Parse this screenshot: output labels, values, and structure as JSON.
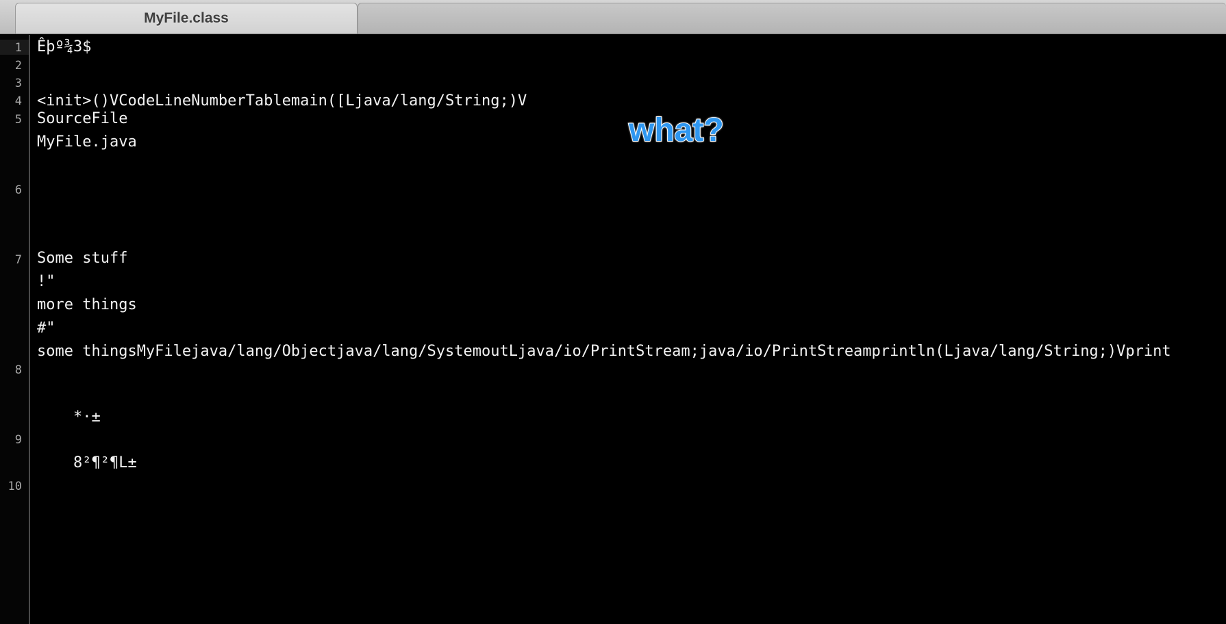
{
  "tabs": [
    {
      "label": "MyFile.class",
      "active": true
    }
  ],
  "editor": {
    "current_line": 1,
    "line_numbers": [
      "1",
      "2",
      "3",
      "4",
      "5",
      "6",
      "7",
      "8",
      "9",
      "10"
    ],
    "lines": [
      "Êþº¾3$",
      "<init>()VCodeLineNumberTablemain([Ljava/lang/String;)V",
      "SourceFile",
      "MyFile.java",
      "Some stuff",
      "!\"",
      "more things",
      "#\"",
      "some thingsMyFilejava/lang/Objectjava/lang/SystemoutLjava/io/PrintStream;java/io/PrintStreamprintln(Ljava/lang/String;)Vprint",
      "    *·±",
      "    8²¶²¶L±"
    ]
  },
  "annotation": {
    "text": "what?",
    "color": "#2f97f0"
  },
  "colors": {
    "background": "#000000",
    "text": "#f2f2f2",
    "gutter_text": "#a8a8a8"
  }
}
